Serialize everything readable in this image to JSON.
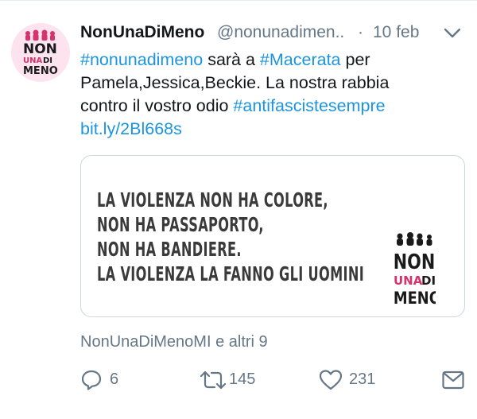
{
  "tweet": {
    "author_name": "NonUnaDiMeno",
    "handle": "@nonunadimen..",
    "separator": "·",
    "date": "10 feb",
    "text": {
      "hashtag1": "#nonunadimeno",
      "part1": " sarà a ",
      "hashtag2": "#Macerata",
      "part2": " per",
      "line2": "Pamela,Jessica,Beckie. La nostra rabbia",
      "line3_text": "contro il vostro odio ",
      "hashtag3": "#antifascistesempre",
      "link": "bit.ly/2Bl668s"
    },
    "card": {
      "lines": [
        "LA VIOLENZA NON HA COLORE,",
        "NON HA PASSAPORTO,",
        "NON HA BANDIERE.",
        "LA VIOLENZA LA FANNO GLI UOMINI"
      ]
    },
    "logo": {
      "word1": "NON",
      "word2a": "UNA",
      "word2b": "DI",
      "word3": "MENO"
    },
    "retweeted_by": "NonUnaDiMenoMI e altri 9",
    "reply_count": "6",
    "retweet_count": "145",
    "like_count": "231"
  },
  "colors": {
    "link": "#1b95e0",
    "muted": "#657786",
    "logo_pink": "#d6336c",
    "logo_black": "#1a1a1a"
  },
  "icons": {
    "menu": "chevron-down-icon",
    "reply": "reply-icon",
    "retweet": "retweet-icon",
    "like": "heart-icon",
    "message": "direct-message-icon"
  }
}
